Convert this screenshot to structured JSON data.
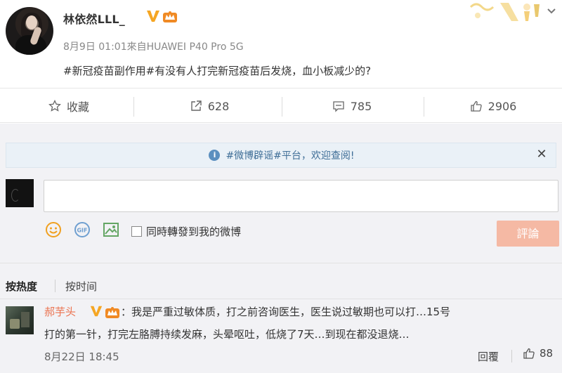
{
  "post": {
    "username": "林依然LLL_",
    "meta": "8月9日 01:01來自HUAWEI P40 Pro 5G",
    "content": "#新冠疫苗副作用#有没有人打完新冠疫苗后发烧，血小板减少的?"
  },
  "actions": {
    "favorite": "收藏",
    "repost": "628",
    "comment": "785",
    "like": "2906"
  },
  "notice": {
    "text": "#微博辟谣#平台，欢迎查阅!"
  },
  "composer": {
    "input_value": "",
    "repost_label": "同時轉發到我的微博",
    "submit_label": "評論"
  },
  "sort": {
    "hot": "按热度",
    "time": "按时间"
  },
  "comments": [
    {
      "name": "郝芋头",
      "text_line1": "：我是严重过敏体质，打之前咨询医生，医生说过敏期也可以打…15号",
      "text_line2": "打的第一针，打完左胳膊持续发麻，头晕呕吐，低烧了7天…到现在都没退烧…",
      "time": "8月22日 18:45",
      "reply": "回覆",
      "likes": "88"
    }
  ],
  "colors": {
    "accent_orange": "#eb7350",
    "submit_disabled": "#f5b9a4",
    "notice_text": "#3f6e97",
    "v_badge": "#f5a623"
  }
}
